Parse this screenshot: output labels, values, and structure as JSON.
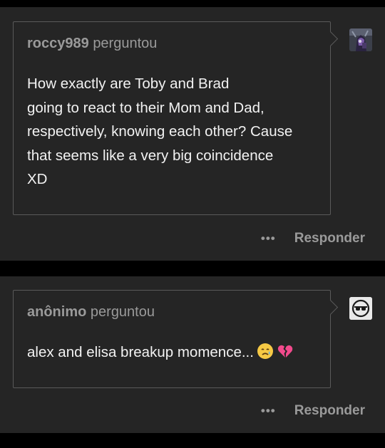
{
  "posts": [
    {
      "asker_name": "roccy989",
      "asker_suffix": "perguntou",
      "question_lines": [
        "How exactly are Toby and Brad",
        "going to react to their Mom and Dad,",
        "respectively, knowing each other? Cause",
        "that seems like a very big coincidence",
        "XD"
      ],
      "more_icon": "ellipsis-icon",
      "more_label": "•••",
      "reply_label": "Responder"
    },
    {
      "asker_name": "anônimo",
      "asker_suffix": "perguntou",
      "question_text": "alex and elisa breakup momence...",
      "emojis": [
        "crying-face-icon",
        "broken-heart-icon"
      ],
      "more_icon": "ellipsis-icon",
      "more_label": "•••",
      "reply_label": "Responder"
    }
  ],
  "colors": {
    "background": "#000000",
    "card": "#252525",
    "border": "#5a5a5a",
    "text": "#f2f2f2",
    "muted": "#9a9a9a"
  }
}
